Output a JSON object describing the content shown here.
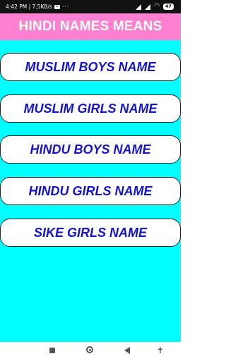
{
  "status_bar": {
    "time_speed": "4:42 PM | 7.5KB/s",
    "more": "···",
    "battery": "47"
  },
  "header": {
    "title": "HINDI NAMES MEANS"
  },
  "menu": {
    "items": [
      {
        "label": "MUSLIM BOYS NAME"
      },
      {
        "label": "MUSLIM GIRLS NAME"
      },
      {
        "label": "HINDU BOYS NAME"
      },
      {
        "label": "HINDU GIRLS NAME"
      },
      {
        "label": "SIKE GIRLS NAME"
      }
    ]
  },
  "colors": {
    "header_bg": "#ff7fd0",
    "content_bg": "#00ffff",
    "button_text": "#1414c8"
  }
}
